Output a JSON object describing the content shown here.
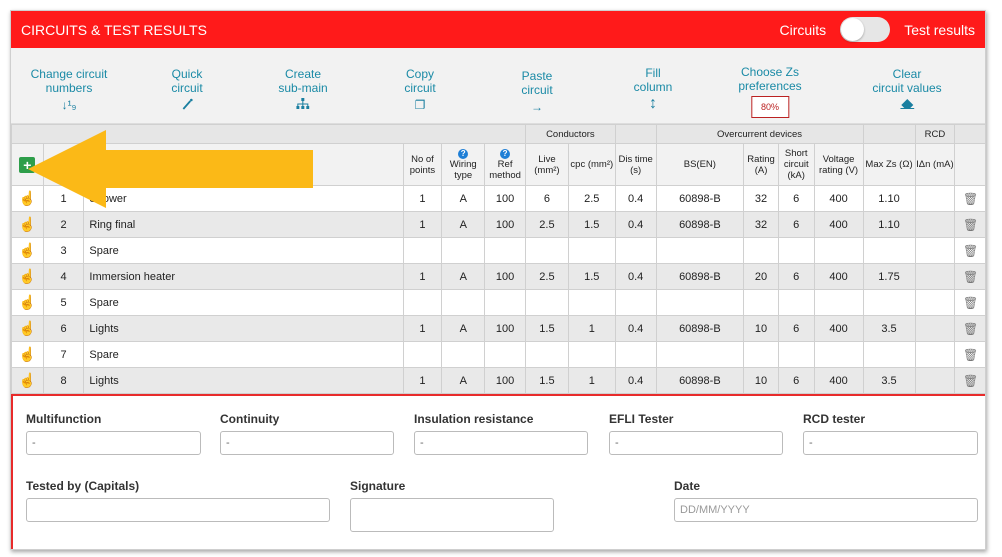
{
  "header": {
    "title": "CIRCUITS & TEST RESULTS",
    "toggle_left": "Circuits",
    "toggle_right": "Test results"
  },
  "toolbar": [
    {
      "line1": "Change circuit",
      "line2": "numbers",
      "icon": "sort-numeric-icon",
      "glyph": "↓¹₉"
    },
    {
      "line1": "Quick",
      "line2": "circuit",
      "icon": "magic-wand-icon",
      "glyph": "🪄"
    },
    {
      "line1": "Create",
      "line2": "sub-main",
      "icon": "hierarchy-icon",
      "glyph": "⊥"
    },
    {
      "line1": "Copy",
      "line2": "circuit",
      "icon": "copy-icon",
      "glyph": "❐"
    },
    {
      "line1": "Paste",
      "line2": "circuit",
      "icon": "arrow-right-icon",
      "glyph": "→"
    },
    {
      "line1": "Fill",
      "line2": "column",
      "icon": "vertical-arrows-icon",
      "glyph": "↕"
    },
    {
      "line1": "Choose Zs",
      "line2": "preferences",
      "badge": "80%"
    },
    {
      "line1": "Clear",
      "line2": "circuit values",
      "icon": "eraser-icon",
      "glyph": "▰"
    }
  ],
  "table": {
    "group_headers": {
      "conductors": "Conductors",
      "overcurrent": "Overcurrent devices",
      "rcd": "RCD"
    },
    "columns": {
      "points": "No of points",
      "wiring": "Wiring type",
      "ref": "Ref method",
      "live": "Live (mm²)",
      "cpc": "cpc (mm²)",
      "dis": "Dis time (s)",
      "bs": "BS(EN)",
      "rating": "Rating (A)",
      "short": "Short circuit (kA)",
      "voltage": "Voltage rating (V)",
      "zs": "Max Zs (Ω)",
      "idn": "IΔn (mA)"
    },
    "rows": [
      {
        "num": "1",
        "desc": "Shower",
        "points": "1",
        "wiring": "A",
        "ref": "100",
        "live": "6",
        "cpc": "2.5",
        "dis": "0.4",
        "bs": "60898-B",
        "rating": "32",
        "short": "6",
        "voltage": "400",
        "zs": "1.10",
        "idn": ""
      },
      {
        "num": "2",
        "desc": "Ring final",
        "points": "1",
        "wiring": "A",
        "ref": "100",
        "live": "2.5",
        "cpc": "1.5",
        "dis": "0.4",
        "bs": "60898-B",
        "rating": "32",
        "short": "6",
        "voltage": "400",
        "zs": "1.10",
        "idn": ""
      },
      {
        "num": "3",
        "desc": "Spare",
        "points": "",
        "wiring": "",
        "ref": "",
        "live": "",
        "cpc": "",
        "dis": "",
        "bs": "",
        "rating": "",
        "short": "",
        "voltage": "",
        "zs": "",
        "idn": ""
      },
      {
        "num": "4",
        "desc": "Immersion heater",
        "points": "1",
        "wiring": "A",
        "ref": "100",
        "live": "2.5",
        "cpc": "1.5",
        "dis": "0.4",
        "bs": "60898-B",
        "rating": "20",
        "short": "6",
        "voltage": "400",
        "zs": "1.75",
        "idn": ""
      },
      {
        "num": "5",
        "desc": "Spare",
        "points": "",
        "wiring": "",
        "ref": "",
        "live": "",
        "cpc": "",
        "dis": "",
        "bs": "",
        "rating": "",
        "short": "",
        "voltage": "",
        "zs": "",
        "idn": ""
      },
      {
        "num": "6",
        "desc": "Lights",
        "points": "1",
        "wiring": "A",
        "ref": "100",
        "live": "1.5",
        "cpc": "1",
        "dis": "0.4",
        "bs": "60898-B",
        "rating": "10",
        "short": "6",
        "voltage": "400",
        "zs": "3.5",
        "idn": ""
      },
      {
        "num": "7",
        "desc": "Spare",
        "points": "",
        "wiring": "",
        "ref": "",
        "live": "",
        "cpc": "",
        "dis": "",
        "bs": "",
        "rating": "",
        "short": "",
        "voltage": "",
        "zs": "",
        "idn": ""
      },
      {
        "num": "8",
        "desc": "Lights",
        "points": "1",
        "wiring": "A",
        "ref": "100",
        "live": "1.5",
        "cpc": "1",
        "dis": "0.4",
        "bs": "60898-B",
        "rating": "10",
        "short": "6",
        "voltage": "400",
        "zs": "3.5",
        "idn": ""
      }
    ]
  },
  "instruments": [
    {
      "label": "Multifunction",
      "value": "-"
    },
    {
      "label": "Continuity",
      "value": "-"
    },
    {
      "label": "Insulation resistance",
      "value": "-"
    },
    {
      "label": "EFLI Tester",
      "value": "-"
    },
    {
      "label": "RCD tester",
      "value": "-"
    }
  ],
  "signoff": {
    "tested_by": "Tested by (Capitals)",
    "signature": "Signature",
    "date": "Date",
    "date_placeholder": "DD/MM/YYYY"
  },
  "colors": {
    "brand": "#ff1a1a",
    "accent": "#1a8aa6",
    "arrow": "#fbb917"
  }
}
